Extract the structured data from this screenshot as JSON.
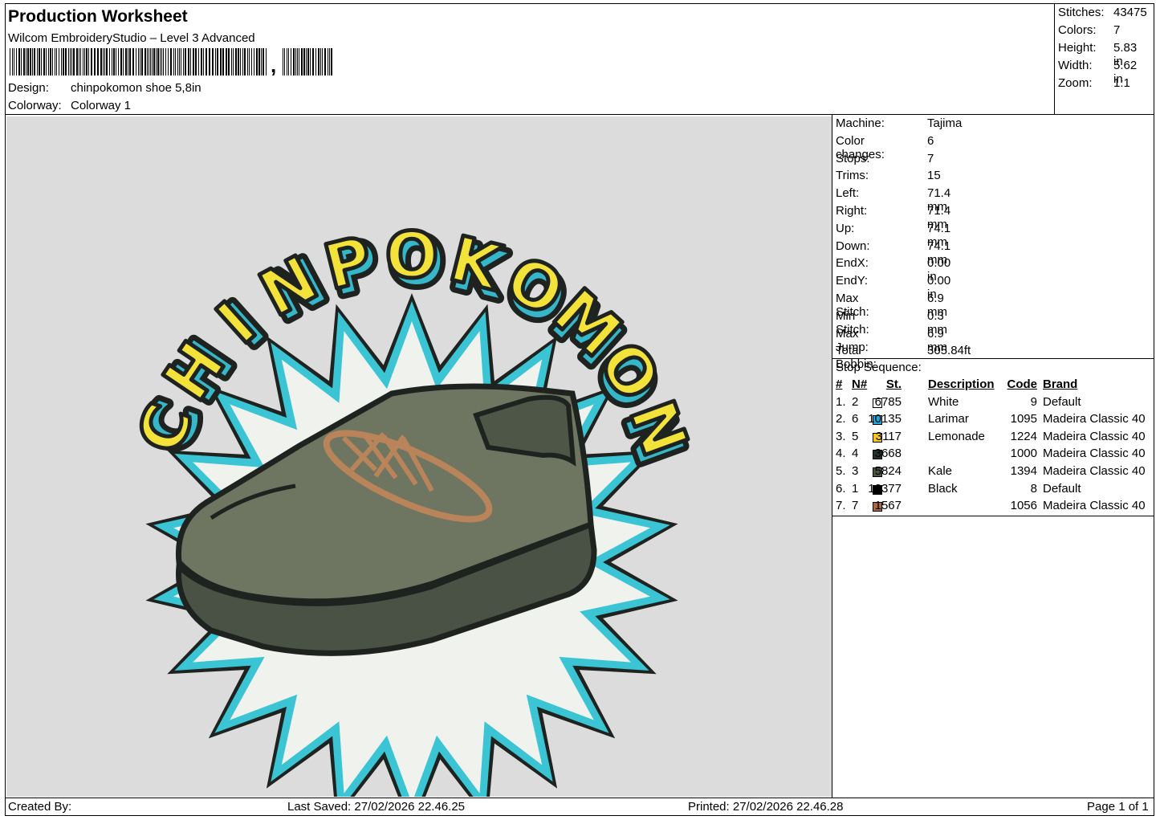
{
  "header": {
    "title": "Production Worksheet",
    "software": "Wilcom EmbroideryStudio – Level 3 Advanced",
    "barcode_trailing_mark": ",",
    "design_label": "Design:",
    "design_value": "chinpokomon shoe 5,8in",
    "colorway_label": "Colorway:",
    "colorway_value": "Colorway 1"
  },
  "stats": [
    {
      "label": "Stitches:",
      "value": "43475"
    },
    {
      "label": "Colors:",
      "value": "7"
    },
    {
      "label": "Height:",
      "value": "5.83 in"
    },
    {
      "label": "Width:",
      "value": "5.62 in"
    },
    {
      "label": "Zoom:",
      "value": "1:1"
    }
  ],
  "design_preview": {
    "text": "CHINPOKOMON",
    "colors": {
      "background": "#dcdcdc",
      "text_fill": "#f2e23a",
      "text_shadow": "#35b6c9",
      "outline": "#1f2320",
      "burst_fill": "#f0f2ee",
      "burst_edge": "#3ac4d4",
      "shoe_upper": "#6e7560",
      "shoe_sole": "#4a5245",
      "lace": "#b9845a"
    }
  },
  "machine": [
    {
      "label": "Machine:",
      "value": "Tajima"
    },
    {
      "label": "Color changes:",
      "value": "6"
    },
    {
      "label": "Stops:",
      "value": "7"
    },
    {
      "label": "Trims:",
      "value": "15"
    },
    {
      "label": "Left:",
      "value": "71.4 mm"
    },
    {
      "label": "Right:",
      "value": "71.4 mm"
    },
    {
      "label": "Up:",
      "value": "74.1 mm"
    },
    {
      "label": "Down:",
      "value": "74.1 mm"
    },
    {
      "label": "EndX:",
      "value": "0.00 in"
    },
    {
      "label": "EndY:",
      "value": "0.00 in"
    },
    {
      "label": "Max Stitch:",
      "value": "6.9 mm"
    },
    {
      "label": "Min Stitch:",
      "value": "0.3 mm"
    },
    {
      "label": "Max Jump:",
      "value": "6.9 mm"
    },
    {
      "label": "Total Bobbin:",
      "value": "305.84ft"
    }
  ],
  "stop_sequence": {
    "title": "Stop Sequence:",
    "headers": {
      "idx": "#",
      "n": "N#",
      "st": "St.",
      "desc": "Description",
      "code": "Code",
      "brand": "Brand"
    },
    "rows": [
      {
        "idx": "1.",
        "n": "2",
        "color": "#ffffff",
        "st": "6785",
        "desc": "White",
        "code": "9",
        "brand": "Default"
      },
      {
        "idx": "2.",
        "n": "6",
        "color": "#1ea7d6",
        "st": "10135",
        "desc": "Larimar",
        "code": "1095",
        "brand": "Madeira Classic 40"
      },
      {
        "idx": "3.",
        "n": "5",
        "color": "#f4c721",
        "st": "3117",
        "desc": "Lemonade",
        "code": "1224",
        "brand": "Madeira Classic 40"
      },
      {
        "idx": "4.",
        "n": "4",
        "color": "#26302b",
        "st": "3668",
        "desc": "",
        "code": "1000",
        "brand": "Madeira Classic 40"
      },
      {
        "idx": "5.",
        "n": "3",
        "color": "#4d5643",
        "st": "5824",
        "desc": "Kale",
        "code": "1394",
        "brand": "Madeira Classic 40"
      },
      {
        "idx": "6.",
        "n": "1",
        "color": "#000000",
        "st": "12377",
        "desc": "Black",
        "code": "8",
        "brand": "Default"
      },
      {
        "idx": "7.",
        "n": "7",
        "color": "#a8694a",
        "st": "1567",
        "desc": "",
        "code": "1056",
        "brand": "Madeira Classic 40"
      }
    ]
  },
  "footer": {
    "created_by": "Created By:",
    "last_saved": "Last Saved: 27/02/2026 22.46.25",
    "printed": "Printed: 27/02/2026 22.46.28",
    "page": "Page 1 of 1"
  }
}
